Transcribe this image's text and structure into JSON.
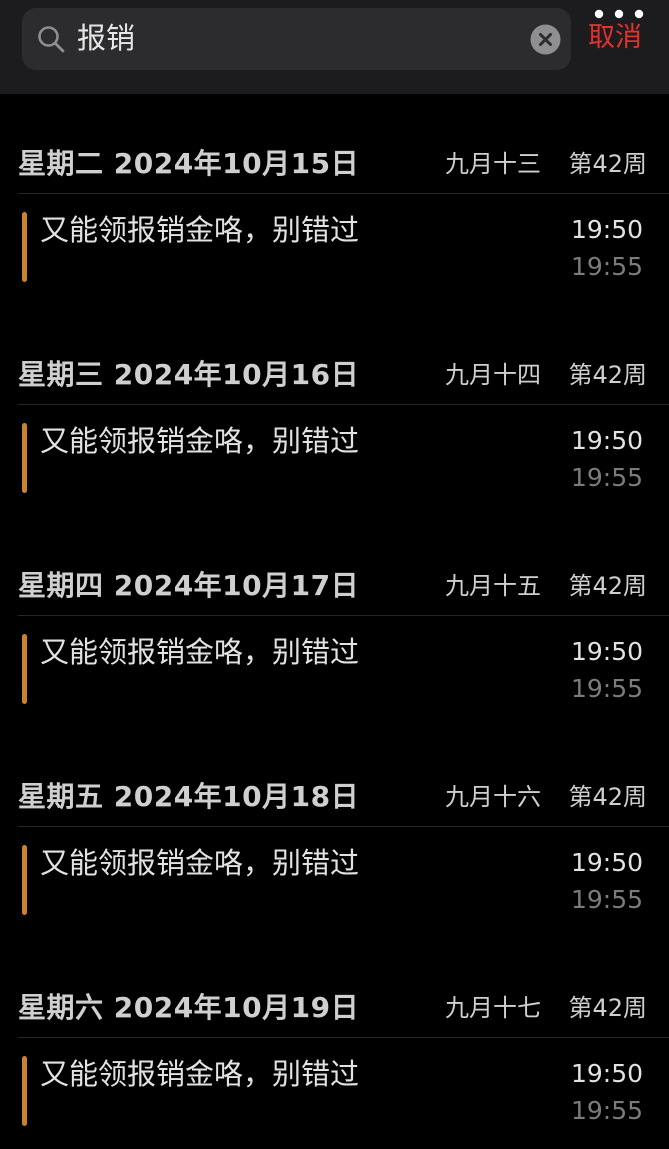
{
  "search": {
    "value": "报销",
    "cancel_label": "取消"
  },
  "colors": {
    "background": "#000000",
    "search_bar_bg": "#2c2c2e",
    "cancel_red": "#e0332e",
    "event_accent": "#c9822e",
    "end_time_gray": "#7b7b7b"
  },
  "icons": {
    "search": "search-icon",
    "clear": "clear-icon",
    "more": "more-icon"
  },
  "days": [
    {
      "date": "星期二 2024年10月15日",
      "lunar": "九月十三",
      "week": "第42周",
      "events": [
        {
          "title": "又能领报销金咯，别错过",
          "start": "19:50",
          "end": "19:55"
        }
      ]
    },
    {
      "date": "星期三 2024年10月16日",
      "lunar": "九月十四",
      "week": "第42周",
      "events": [
        {
          "title": "又能领报销金咯，别错过",
          "start": "19:50",
          "end": "19:55"
        }
      ]
    },
    {
      "date": "星期四 2024年10月17日",
      "lunar": "九月十五",
      "week": "第42周",
      "events": [
        {
          "title": "又能领报销金咯，别错过",
          "start": "19:50",
          "end": "19:55"
        }
      ]
    },
    {
      "date": "星期五 2024年10月18日",
      "lunar": "九月十六",
      "week": "第42周",
      "events": [
        {
          "title": "又能领报销金咯，别错过",
          "start": "19:50",
          "end": "19:55"
        }
      ]
    },
    {
      "date": "星期六 2024年10月19日",
      "lunar": "九月十七",
      "week": "第42周",
      "events": [
        {
          "title": "又能领报销金咯，别错过",
          "start": "19:50",
          "end": "19:55"
        }
      ]
    }
  ]
}
